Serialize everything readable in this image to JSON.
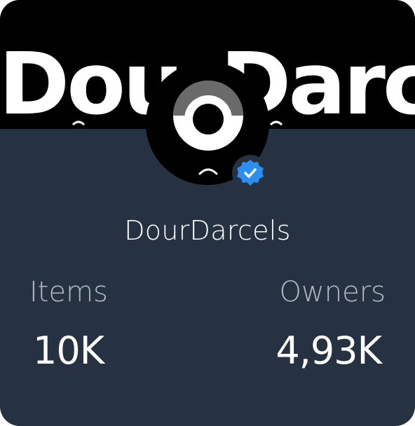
{
  "banner": {
    "text": "DourDarcels"
  },
  "collection": {
    "name": "DourDarcels",
    "verified": true
  },
  "stats": {
    "items_label": "Items",
    "items_value": "10K",
    "owners_label": "Owners",
    "owners_value": "4,93K"
  },
  "colors": {
    "card_background": "#263241",
    "banner_background": "#000000",
    "verified_badge": "#2b8ef0",
    "stat_label": "#b3bac4",
    "text_primary": "#ffffff"
  },
  "icons": {
    "avatar": "eye-character-icon",
    "badge": "verified-check-icon"
  }
}
